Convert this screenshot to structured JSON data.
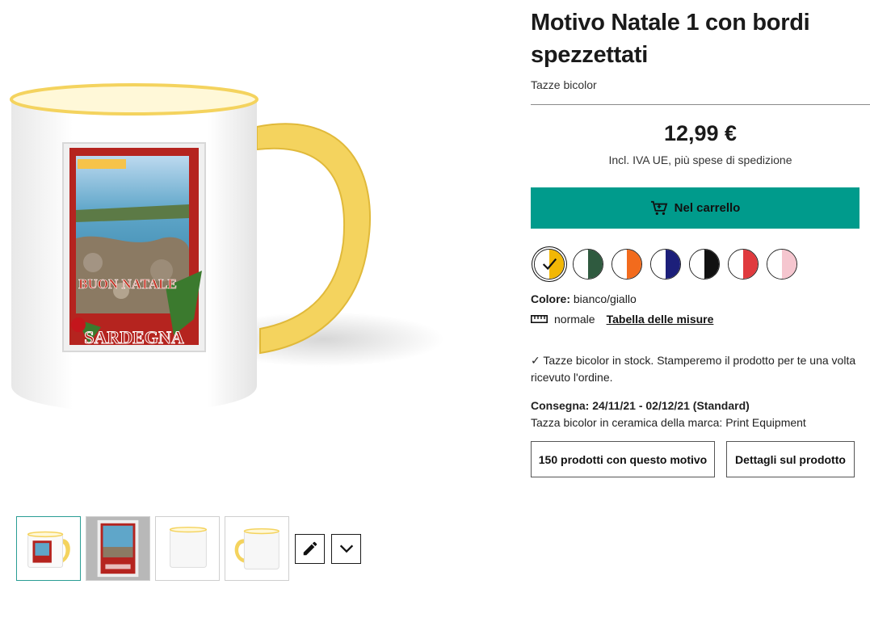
{
  "product": {
    "title": "Motivo Natale 1 con bordi spezzettati",
    "category": "Tazze bicolor",
    "image_text": {
      "line1": "BUON NATALE",
      "line2": "SARDEGNA"
    }
  },
  "pricing": {
    "price": "12,99 €",
    "note": "Incl. IVA UE, più spese di spedizione"
  },
  "cart": {
    "button_label": "Nel carrello"
  },
  "colors": {
    "swatches": [
      {
        "name": "bianco/giallo",
        "color": "#f2b705",
        "selected": true
      },
      {
        "name": "bianco/verde scuro",
        "color": "#2f5a3f",
        "selected": false
      },
      {
        "name": "bianco/arancione",
        "color": "#f26b1d",
        "selected": false
      },
      {
        "name": "bianco/blu",
        "color": "#1c1f7a",
        "selected": false
      },
      {
        "name": "bianco/nero",
        "color": "#111111",
        "selected": false
      },
      {
        "name": "bianco/rosso",
        "color": "#e03a3e",
        "selected": false
      },
      {
        "name": "bianco/rosa",
        "color": "#f5c6cf",
        "selected": false
      }
    ],
    "label": "Colore:",
    "value": "bianco/giallo"
  },
  "size": {
    "value": "normale",
    "link": "Tabella delle misure"
  },
  "stock": {
    "text": "Tazze bicolor in stock. Stamperemo il prodotto per te una volta ricevuto l'ordine."
  },
  "delivery": {
    "label": "Consegna: 24/11/21 - 02/12/21 (Standard)",
    "brand": "Tazza bicolor in ceramica della marca: Print Equipment"
  },
  "actions": {
    "motif_products": "150 prodotti con questo motivo",
    "product_details": "Dettagli sul prodotto"
  },
  "theme": {
    "accent": "#009b8c",
    "mug_accent": "#f4d35e"
  }
}
